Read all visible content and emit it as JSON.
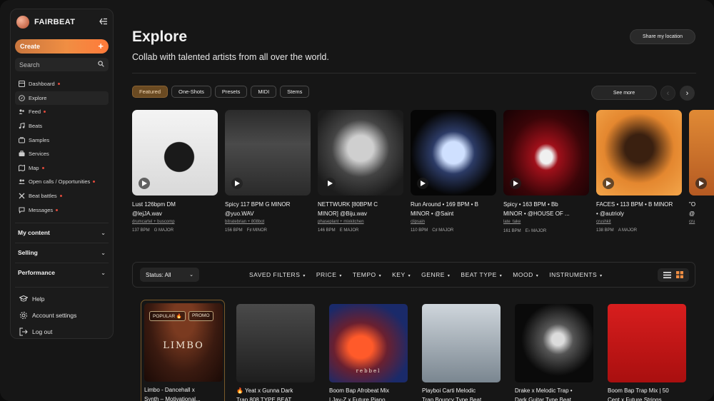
{
  "brand": {
    "name": "FAIRBEAT"
  },
  "sidebar": {
    "create_label": "Create",
    "search_placeholder": "Search",
    "items": [
      {
        "label": "Dashboard",
        "icon": "dashboard-icon",
        "dot": true
      },
      {
        "label": "Explore",
        "icon": "explore-icon",
        "dot": false,
        "active": true
      },
      {
        "label": "Feed",
        "icon": "feed-icon",
        "dot": true
      },
      {
        "label": "Beats",
        "icon": "music-note-icon",
        "dot": false
      },
      {
        "label": "Samples",
        "icon": "samples-icon",
        "dot": false
      },
      {
        "label": "Services",
        "icon": "services-icon",
        "dot": false
      },
      {
        "label": "Map",
        "icon": "map-icon",
        "dot": true
      },
      {
        "label": "Open calls / Opportunities",
        "icon": "open-calls-icon",
        "dot": true
      },
      {
        "label": "Beat battles",
        "icon": "battles-icon",
        "dot": true
      },
      {
        "label": "Messages",
        "icon": "messages-icon",
        "dot": true
      }
    ],
    "sections": [
      "My content",
      "Selling",
      "Performance"
    ],
    "bottom": [
      {
        "label": "Help",
        "icon": "graduation-cap-icon"
      },
      {
        "label": "Account settings",
        "icon": "gear-icon"
      },
      {
        "label": "Log out",
        "icon": "logout-icon"
      }
    ]
  },
  "header": {
    "title": "Explore",
    "subtitle": "Collab with talented artists from all over the world.",
    "share_label": "Share my location"
  },
  "chips": [
    "Featured",
    "One-Shots",
    "Presets",
    "MIDI",
    "Stems"
  ],
  "see_more_label": "See more",
  "featured": [
    {
      "title": "Lust 126bpm DM\n@lejJA.wav",
      "credit": "drumcartel + buscomp",
      "bpm": "137 BPM",
      "key": "G MAJOR",
      "art": "#d8d8d8"
    },
    {
      "title": "Spicy 117 BPM G MINOR\n@yuo.WAV",
      "credit": "bitratebrian + 808bot",
      "bpm": "156 BPM",
      "key": "F♯ MINOR",
      "art": "#3a3a3a"
    },
    {
      "title": "NETTWURK [80BPM C\nMINOR] @Biju.wav",
      "credit": "phaseplant + mixkitchen",
      "bpm": "146 BPM",
      "key": "E MAJOR",
      "art": "#777"
    },
    {
      "title": "Run Around • 169 BPM • B\nMINOR • @Saint",
      "credit": "clipsain",
      "bpm": "110 BPM",
      "key": "C♯ MAJOR",
      "art": "#111"
    },
    {
      "title": "Spicy • 163 BPM • Bb\nMINOR • @HOUSE OF ...",
      "credit": "late_take",
      "bpm": "161 BPM",
      "key": "E♭ MAJOR",
      "art": "#5a0a10"
    },
    {
      "title": "FACES • 113 BPM • B MINOR\n• @autrioly",
      "credit": "crushkit",
      "bpm": "138 BPM",
      "key": "A MAJOR",
      "art": "#d07a2a"
    },
    {
      "title": "\"O\n@",
      "credit": "cru",
      "bpm": "",
      "key": "",
      "art": "#c86a2a"
    }
  ],
  "filterbar": {
    "status_label": "Status: All",
    "filters": [
      "SAVED FILTERS",
      "PRICE",
      "TEMPO",
      "KEY",
      "GENRE",
      "BEAT TYPE",
      "MOOD",
      "INSTRUMENTS"
    ]
  },
  "grid": [
    {
      "title": "Limbo - Dancehall x\nSynth – Motivational...",
      "badges": [
        "POPULAR 🔥",
        "PROMO"
      ],
      "art_text": "LIMBO"
    },
    {
      "title": "🔥 Yeat x Gunna Dark\nTrap 808 TYPE BEAT"
    },
    {
      "title": "Boom Bap Afrobeat Mix\n| Jay-Z x Future Piano...",
      "art_text": "rebbel"
    },
    {
      "title": "Playboi Carti Melodic\nTrap Bouncy Type Beat..."
    },
    {
      "title": "Drake x Melodic Trap •\nDark Guitar Type Beat"
    },
    {
      "title": "Boom Bap Trap Mix | 50\nCent x Future Strings..."
    }
  ],
  "colors": {
    "accent": "#f08e43",
    "background": "#161616",
    "dot": "#e14a3b"
  }
}
